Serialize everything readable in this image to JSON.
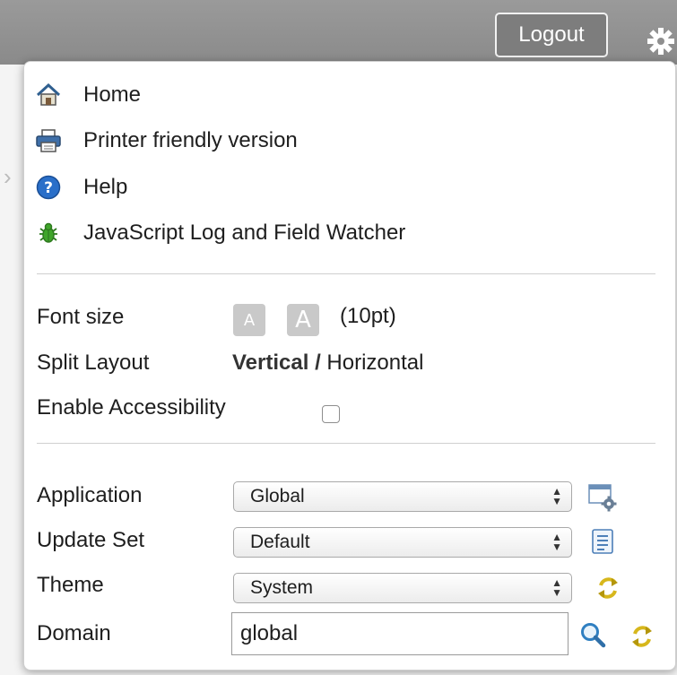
{
  "header": {
    "logout_label": "Logout"
  },
  "menu": {
    "items": [
      {
        "label": "Home",
        "icon": "home-icon"
      },
      {
        "label": "Printer friendly version",
        "icon": "printer-icon"
      },
      {
        "label": "Help",
        "icon": "help-icon"
      },
      {
        "label": "JavaScript Log and Field Watcher",
        "icon": "bug-icon"
      }
    ]
  },
  "display": {
    "font_size_label": "Font size",
    "font_small_glyph": "A",
    "font_large_glyph": "A",
    "font_size_value": "(10pt)",
    "split_layout_label": "Split Layout",
    "split_vertical": "Vertical",
    "split_separator": " / ",
    "split_horizontal": "Horizontal",
    "accessibility_label": "Enable Accessibility",
    "accessibility_checked": false
  },
  "context": {
    "application_label": "Application",
    "application_value": "Global",
    "update_set_label": "Update Set",
    "update_set_value": "Default",
    "theme_label": "Theme",
    "theme_value": "System",
    "domain_label": "Domain",
    "domain_value": "global"
  },
  "colors": {
    "topbar": "#8f8f8f",
    "help_blue": "#2a6fc9",
    "bug_green": "#3fa52a",
    "refresh_yellow": "#d7b71c"
  }
}
